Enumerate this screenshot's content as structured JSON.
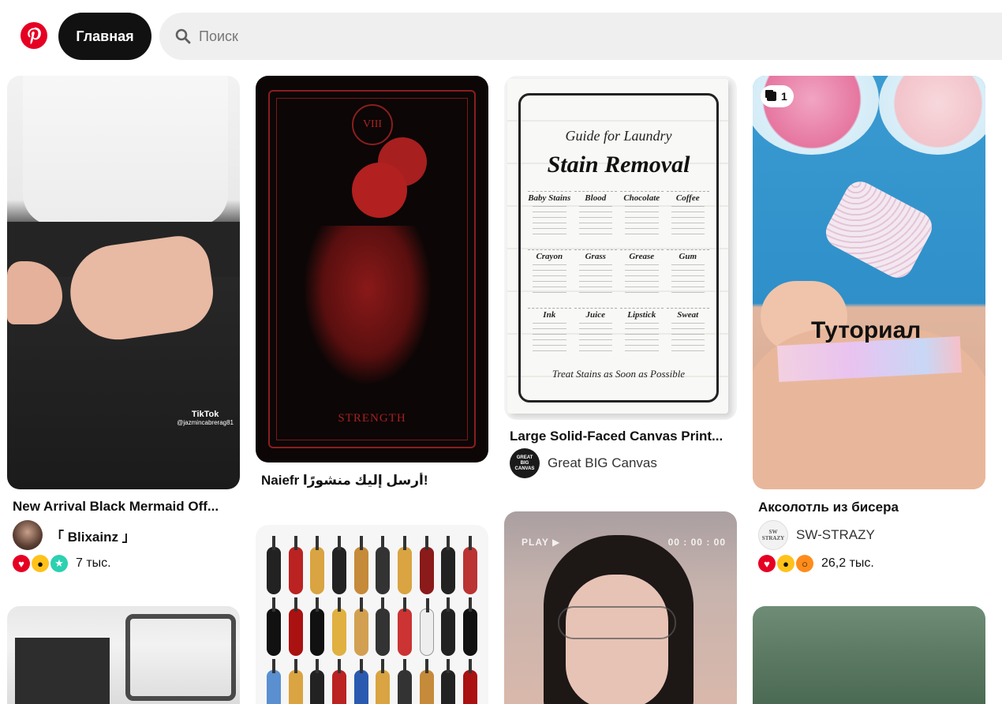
{
  "header": {
    "home_label": "Главная",
    "search_placeholder": "Поиск"
  },
  "pins": [
    {
      "title": "New Arrival Black Mermaid Off...",
      "author": "「 Blixainz 」",
      "reactions_count": "7 тыс.",
      "overlay_brand": "TikTok",
      "overlay_handle": "@jazmincabrerag81"
    },
    {
      "title": "Naiefr أرسل إليك منشورًا!",
      "card_number": "VIII",
      "card_name": "STRENGTH"
    },
    {
      "title": "Large Solid-Faced Canvas Print...",
      "author": "Great BIG Canvas",
      "avatar_text": "GREAT BIG CANVAS",
      "canvas_heading_1": "Guide for Laundry",
      "canvas_heading_2": "Stain Removal",
      "stains": [
        "Baby Stains",
        "Blood",
        "Chocolate",
        "Coffee",
        "Crayon",
        "Grass",
        "Grease",
        "Gum",
        "Ink",
        "Juice",
        "Lipstick",
        "Sweat"
      ],
      "canvas_footer": "Treat Stains as Soon as Possible"
    },
    {
      "title": "Аксолотль из бисера",
      "author": "SW-STRAZY",
      "avatar_text": "SW STRAZY",
      "reactions_count": "26,2 тыс.",
      "overlay_text": "Туториал",
      "badge_count": "1"
    }
  ],
  "video_hud": {
    "play": "PLAY ▶",
    "time": "00 : 00 : 00"
  },
  "colors": {
    "brand": "#e60023",
    "home_bg": "#111111",
    "search_bg": "#efefef"
  },
  "icons": [
    "pinterest-logo-icon",
    "search-icon",
    "heart-icon",
    "wow-face-icon",
    "sparkle-face-icon",
    "surprised-face-icon",
    "multi-image-icon"
  ]
}
